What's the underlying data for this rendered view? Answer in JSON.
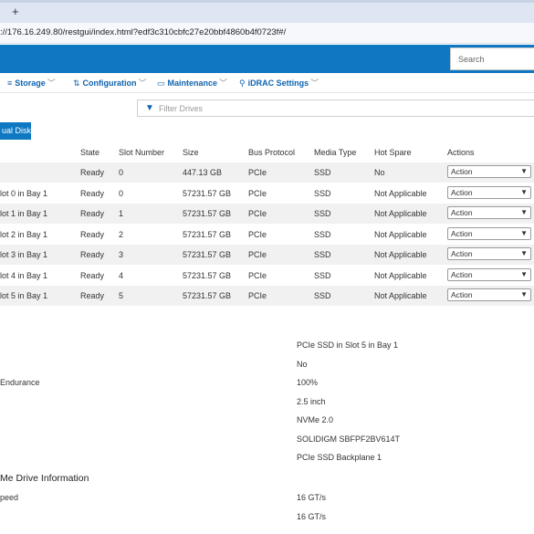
{
  "browser": {
    "new_tab": "+",
    "url": "://176.16.249.80/restgui/index.html?edf3c310cbfc27e20bbf4860b4f0723f#/"
  },
  "header": {
    "search_placeholder": "Search"
  },
  "nav": [
    {
      "label": "Storage",
      "icon": "database-icon",
      "glyph": "≡"
    },
    {
      "label": "Configuration",
      "icon": "sliders-icon",
      "glyph": "⇅"
    },
    {
      "label": "Maintenance",
      "icon": "wrench-icon",
      "glyph": "▭"
    },
    {
      "label": "iDRAC Settings",
      "icon": "key-icon",
      "glyph": "⚲"
    }
  ],
  "filter": {
    "placeholder": "Filter Drives"
  },
  "virtual_disk_button": "ual Disk",
  "table": {
    "columns": [
      "State",
      "Slot Number",
      "Size",
      "Bus Protocol",
      "Media Type",
      "Hot Spare",
      "Actions"
    ],
    "rows": [
      {
        "name": "",
        "state": "Ready",
        "slot": "0",
        "size": "447.13 GB",
        "bus": "PCIe",
        "media": "SSD",
        "hotspare": "No",
        "action": "Action"
      },
      {
        "name": "lot 0 in Bay 1",
        "state": "Ready",
        "slot": "0",
        "size": "57231.57 GB",
        "bus": "PCIe",
        "media": "SSD",
        "hotspare": "Not Applicable",
        "action": "Action"
      },
      {
        "name": "lot 1 in Bay 1",
        "state": "Ready",
        "slot": "1",
        "size": "57231.57 GB",
        "bus": "PCIe",
        "media": "SSD",
        "hotspare": "Not Applicable",
        "action": "Action"
      },
      {
        "name": "lot 2 in Bay 1",
        "state": "Ready",
        "slot": "2",
        "size": "57231.57 GB",
        "bus": "PCIe",
        "media": "SSD",
        "hotspare": "Not Applicable",
        "action": "Action"
      },
      {
        "name": "lot 3 in Bay 1",
        "state": "Ready",
        "slot": "3",
        "size": "57231.57 GB",
        "bus": "PCIe",
        "media": "SSD",
        "hotspare": "Not Applicable",
        "action": "Action"
      },
      {
        "name": "lot 4 in Bay 1",
        "state": "Ready",
        "slot": "4",
        "size": "57231.57 GB",
        "bus": "PCIe",
        "media": "SSD",
        "hotspare": "Not Applicable",
        "action": "Action"
      },
      {
        "name": "lot 5 in Bay 1",
        "state": "Ready",
        "slot": "5",
        "size": "57231.57 GB",
        "bus": "PCIe",
        "media": "SSD",
        "hotspare": "Not Applicable",
        "action": "Action"
      }
    ]
  },
  "details": [
    {
      "label": "",
      "value": "PCIe SSD in Slot 5 in Bay 1"
    },
    {
      "label": "",
      "value": "No"
    },
    {
      "label": "Endurance",
      "value": "100%"
    },
    {
      "label": "",
      "value": "2.5 inch"
    },
    {
      "label": "",
      "value": "NVMe 2.0"
    },
    {
      "label": "",
      "value": "SOLIDIGM SBFPF2BV614T"
    },
    {
      "label": "",
      "value": "PCIe SSD Backplane 1"
    }
  ],
  "nvme_section": {
    "title": "Me Drive Information",
    "items": [
      {
        "label": "peed",
        "value": "16 GT/s"
      },
      {
        "label": "",
        "value": "16 GT/s"
      }
    ]
  },
  "colors": {
    "accent": "#0e78c2",
    "nav_text": "#0e63ae"
  }
}
